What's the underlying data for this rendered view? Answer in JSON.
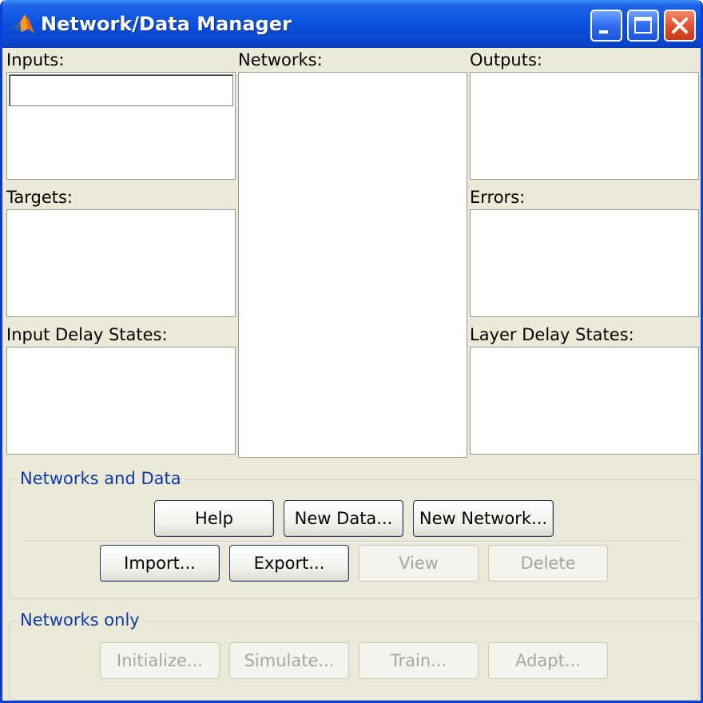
{
  "window": {
    "title": "Network/Data Manager"
  },
  "panels": {
    "inputs": "Inputs:",
    "targets": "Targets:",
    "input_delay_states": "Input Delay States:",
    "networks": "Networks:",
    "outputs": "Outputs:",
    "errors": "Errors:",
    "layer_delay_states": "Layer Delay States:"
  },
  "networks_and_data": {
    "title": "Networks and Data",
    "buttons": {
      "help": "Help",
      "new_data": "New Data...",
      "new_network": "New Network...",
      "import": "Import...",
      "export": "Export...",
      "view": "View",
      "delete": "Delete"
    }
  },
  "networks_only": {
    "title": "Networks only",
    "buttons": {
      "initialize": "Initialize...",
      "simulate": "Simulate...",
      "train": "Train...",
      "adapt": "Adapt..."
    }
  },
  "colors": {
    "titlebar": "#0b52df",
    "window_bg": "#ece9d8",
    "group_title": "#0b3aa8",
    "disabled_text": "#a7a69c"
  }
}
